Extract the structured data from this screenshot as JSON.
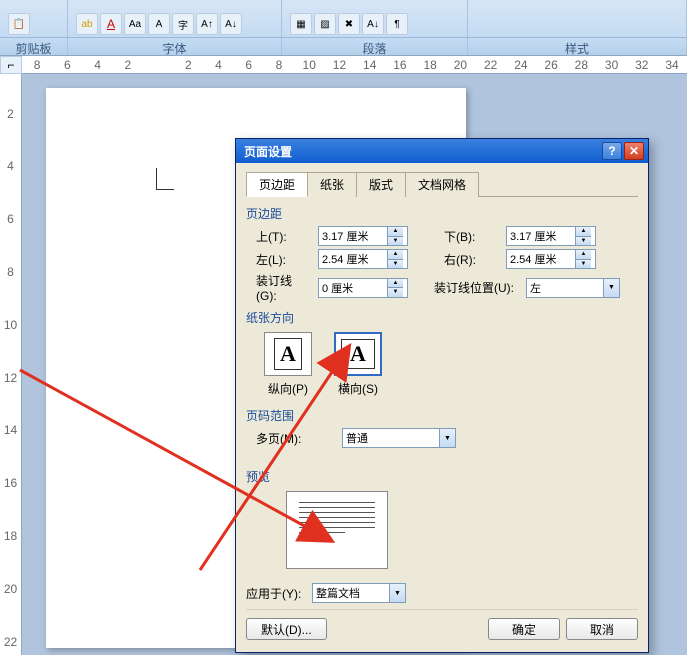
{
  "ribbon": {
    "groups": {
      "clipboard": "剪贴板",
      "font": "字体",
      "paragraph": "段落",
      "styles": "样式"
    }
  },
  "h_ruler": [
    "8",
    "6",
    "4",
    "2",
    "",
    "2",
    "4",
    "6",
    "8",
    "10",
    "12",
    "14",
    "16",
    "18",
    "20",
    "22",
    "24",
    "26",
    "28",
    "30",
    "32",
    "34"
  ],
  "v_ruler": [
    "",
    "2",
    "",
    "4",
    "",
    "6",
    "",
    "8",
    "",
    "10",
    "",
    "12",
    "",
    "14",
    "",
    "16",
    "",
    "18",
    "",
    "20",
    "",
    "22"
  ],
  "dialog": {
    "title": "页面设置",
    "tabs": {
      "margins": "页边距",
      "paper": "纸张",
      "layout": "版式",
      "grid": "文档网格"
    },
    "section_margins": "页边距",
    "top_label": "上(T):",
    "top_value": "3.17 厘米",
    "bottom_label": "下(B):",
    "bottom_value": "3.17 厘米",
    "left_label": "左(L):",
    "left_value": "2.54 厘米",
    "right_label": "右(R):",
    "right_value": "2.54 厘米",
    "gutter_label": "装订线(G):",
    "gutter_value": "0 厘米",
    "gutter_pos_label": "装订线位置(U):",
    "gutter_pos_value": "左",
    "section_orientation": "纸张方向",
    "portrait": "纵向(P)",
    "landscape": "横向(S)",
    "section_pagerange": "页码范围",
    "multipage_label": "多页(M):",
    "multipage_value": "普通",
    "section_preview": "预览",
    "applyto_label": "应用于(Y):",
    "applyto_value": "整篇文档",
    "default_btn": "默认(D)...",
    "ok_btn": "确定",
    "cancel_btn": "取消"
  }
}
